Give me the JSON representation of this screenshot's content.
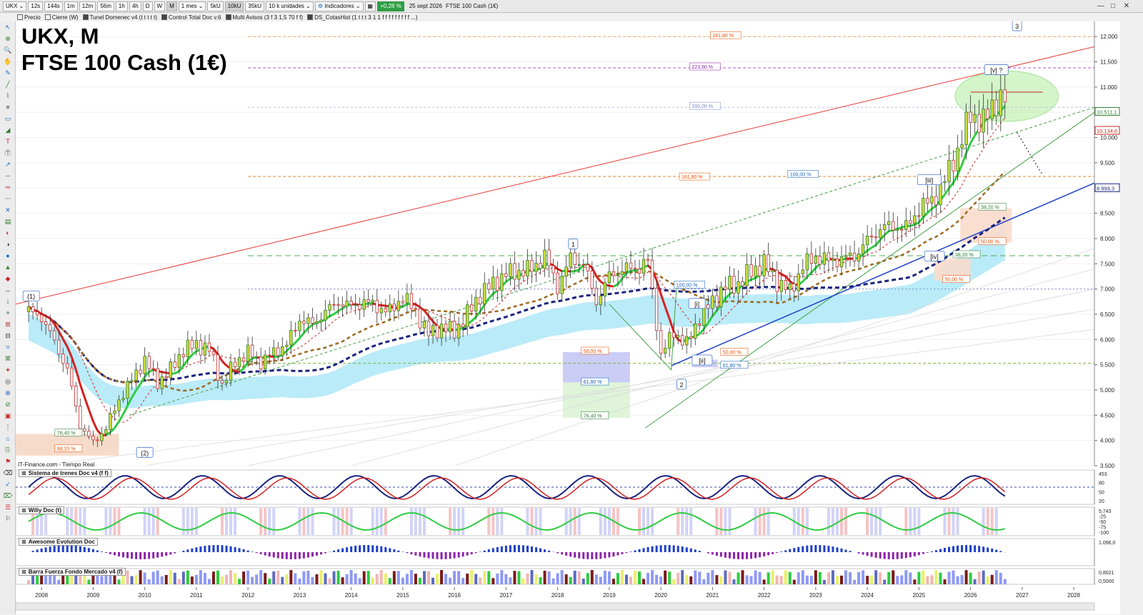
{
  "toolbar": {
    "symbol": "UKX",
    "timeframes": [
      "12s",
      "144s",
      "1m",
      "12m",
      "56m",
      "1h",
      "4h",
      "D",
      "W",
      "M"
    ],
    "period": "1 mes",
    "units_a": "5kU",
    "units_b": "10kU",
    "units_c": "35kU",
    "units_select": "10 k unidades",
    "indicators": "Indicadores",
    "change_pct": "+0,28 %",
    "date": "25 sept 2026",
    "instrument": "FTSE 100 Cash (1€)"
  },
  "legend_items": [
    "Precio",
    "Cierre (W)",
    "Tunel Domenec v4 (t t t t t)",
    "Control Total Doc v.6",
    "Multi Avisos (3 f 3 1,5 70 f f)",
    "DS_CotasHist (1 t t t 3 1 1 f f f f f f f f f ...)"
  ],
  "title": {
    "line1": "UKX, M",
    "line2": "FTSE 100 Cash (1€)"
  },
  "source_label": "IT-Finance.com - Tiempo Real",
  "panes": {
    "p1": "Sistema de trenes Doc v4 (f f)",
    "p2": "Willy Doc (t)",
    "p3": "Awesome Evolution Doc",
    "p4": "Barra Fuerza Fondo Mercado v4 (f)"
  },
  "pane_axis": {
    "p1": [
      "453",
      "80",
      "50",
      "20"
    ],
    "p2": [
      "5,743",
      "-25",
      "-50",
      "-75",
      "-100"
    ],
    "p3": [
      "1.096,0"
    ],
    "p4": [
      "0,8021",
      "0,5000"
    ]
  },
  "price_tags": [
    {
      "label": "10.511,1",
      "value": 10511,
      "color": "#2e7d32"
    },
    {
      "label": "10.134,6",
      "value": 10135,
      "color": "#c62828"
    },
    {
      "label": "8.999,3",
      "value": 8999,
      "color": "#1a237e"
    }
  ],
  "fib_labels": [
    {
      "text": "161,80 %",
      "value": 12000,
      "color": "#e65100"
    },
    {
      "text": "223,60 %",
      "value": 11380,
      "color": "#8e24aa"
    },
    {
      "text": "200,00 %",
      "value": 10600,
      "color": "#7986cb"
    },
    {
      "text": "161,80 %",
      "value": 9200,
      "color": "#e65100"
    },
    {
      "text": "100,00 %",
      "value": 9250,
      "color": "#1565c0"
    },
    {
      "text": "38,20 %",
      "value": 8600,
      "color": "#2e7d32"
    },
    {
      "text": "50,00 %",
      "value": 7920,
      "color": "#e65100"
    },
    {
      "text": "38,20 %",
      "value": 7660,
      "color": "#2e7d32"
    },
    {
      "text": "50,00 %",
      "value": 7170,
      "color": "#e65100"
    },
    {
      "text": "100,00 %",
      "value": 7060,
      "color": "#1565c0"
    },
    {
      "text": "50,00 %",
      "value": 5750,
      "color": "#e65100"
    },
    {
      "text": "61,80 %",
      "value": 5140,
      "color": "#1565c0"
    },
    {
      "text": "76,40 %",
      "value": 4470,
      "color": "#2e7d32"
    },
    {
      "text": "50,00 %",
      "value": 5730,
      "color": "#e65100"
    },
    {
      "text": "61,80 %",
      "value": 5470,
      "color": "#1565c0"
    },
    {
      "text": "76,40 %",
      "value": 4130,
      "color": "#2e7d32"
    },
    {
      "text": "88,20 %",
      "value": 3820,
      "color": "#e65100"
    }
  ],
  "wave_labels": [
    "(1)",
    "(2)",
    "1",
    "2",
    "3",
    "[i]",
    "[ii]",
    "[iii]",
    "[iv]",
    "[v] ?"
  ],
  "colors": {
    "up_candle": "#2e7d32",
    "down_candle": "#c62828",
    "up_fill": "#cddc39",
    "tunnel_fill": "#aee8f7",
    "long_ma": "#1a237e",
    "trend_line": "#e53935",
    "support_line": "#1e3fc8"
  },
  "chart_data": {
    "type": "candlestick",
    "title": "UKX, M",
    "subtitle": "FTSE 100 Cash (1€)",
    "frequency": "monthly",
    "x_ticks": [
      "2008",
      "2009",
      "2010",
      "2011",
      "2012",
      "2013",
      "2014",
      "2015",
      "2016",
      "2017",
      "2018",
      "2019",
      "2020",
      "2021",
      "2022",
      "2023",
      "2024",
      "2025",
      "2026",
      "2027",
      "2028"
    ],
    "y_ticks": [
      "3.500",
      "4.000",
      "4.500",
      "5.000",
      "5.500",
      "6.000",
      "6.500",
      "7.000",
      "7.500",
      "8.000",
      "8.500",
      "9.000",
      "9.500",
      "10.000",
      "10.500",
      "11.000",
      "11.500",
      "12.000"
    ],
    "ylim": [
      3500,
      12300
    ],
    "xlim_years": [
      2007.5,
      2028.4
    ],
    "quarterly_close": [
      {
        "t": 2007.75,
        "close": 6550
      },
      {
        "t": 2008.0,
        "close": 6450
      },
      {
        "t": 2008.25,
        "close": 5950
      },
      {
        "t": 2008.5,
        "close": 5400
      },
      {
        "t": 2008.75,
        "close": 4300
      },
      {
        "t": 2009.0,
        "close": 3950
      },
      {
        "t": 2009.25,
        "close": 4250
      },
      {
        "t": 2009.5,
        "close": 4800
      },
      {
        "t": 2009.75,
        "close": 5200
      },
      {
        "t": 2010.0,
        "close": 5600
      },
      {
        "t": 2010.25,
        "close": 5150
      },
      {
        "t": 2010.5,
        "close": 5400
      },
      {
        "t": 2010.75,
        "close": 5800
      },
      {
        "t": 2011.0,
        "close": 5900
      },
      {
        "t": 2011.25,
        "close": 5800
      },
      {
        "t": 2011.5,
        "close": 5100
      },
      {
        "t": 2011.75,
        "close": 5550
      },
      {
        "t": 2012.0,
        "close": 5750
      },
      {
        "t": 2012.25,
        "close": 5550
      },
      {
        "t": 2012.5,
        "close": 5750
      },
      {
        "t": 2012.75,
        "close": 5900
      },
      {
        "t": 2013.0,
        "close": 6400
      },
      {
        "t": 2013.25,
        "close": 6300
      },
      {
        "t": 2013.5,
        "close": 6550
      },
      {
        "t": 2013.75,
        "close": 6750
      },
      {
        "t": 2014.0,
        "close": 6650
      },
      {
        "t": 2014.25,
        "close": 6750
      },
      {
        "t": 2014.5,
        "close": 6650
      },
      {
        "t": 2014.75,
        "close": 6550
      },
      {
        "t": 2015.0,
        "close": 6850
      },
      {
        "t": 2015.25,
        "close": 6550
      },
      {
        "t": 2015.5,
        "close": 6100
      },
      {
        "t": 2015.75,
        "close": 6250
      },
      {
        "t": 2016.0,
        "close": 6150
      },
      {
        "t": 2016.25,
        "close": 6500
      },
      {
        "t": 2016.5,
        "close": 6900
      },
      {
        "t": 2016.75,
        "close": 7100
      },
      {
        "t": 2017.0,
        "close": 7300
      },
      {
        "t": 2017.25,
        "close": 7350
      },
      {
        "t": 2017.5,
        "close": 7400
      },
      {
        "t": 2017.75,
        "close": 7650
      },
      {
        "t": 2018.0,
        "close": 7050
      },
      {
        "t": 2018.25,
        "close": 7600
      },
      {
        "t": 2018.5,
        "close": 7500
      },
      {
        "t": 2018.75,
        "close": 6750
      },
      {
        "t": 2019.0,
        "close": 7250
      },
      {
        "t": 2019.25,
        "close": 7400
      },
      {
        "t": 2019.5,
        "close": 7400
      },
      {
        "t": 2019.75,
        "close": 7550
      },
      {
        "t": 2020.0,
        "close": 5700
      },
      {
        "t": 2020.25,
        "close": 6150
      },
      {
        "t": 2020.5,
        "close": 5900
      },
      {
        "t": 2020.75,
        "close": 6450
      },
      {
        "t": 2021.0,
        "close": 6750
      },
      {
        "t": 2021.25,
        "close": 7050
      },
      {
        "t": 2021.5,
        "close": 7100
      },
      {
        "t": 2021.75,
        "close": 7350
      },
      {
        "t": 2022.0,
        "close": 7500
      },
      {
        "t": 2022.25,
        "close": 7150
      },
      {
        "t": 2022.5,
        "close": 6950
      },
      {
        "t": 2022.75,
        "close": 7450
      },
      {
        "t": 2023.0,
        "close": 7650
      },
      {
        "t": 2023.25,
        "close": 7550
      },
      {
        "t": 2023.5,
        "close": 7600
      },
      {
        "t": 2023.75,
        "close": 7650
      },
      {
        "t": 2024.0,
        "close": 7950
      },
      {
        "t": 2024.25,
        "close": 8200
      },
      {
        "t": 2024.5,
        "close": 8250
      },
      {
        "t": 2024.75,
        "close": 8200
      },
      {
        "t": 2025.0,
        "close": 8600
      },
      {
        "t": 2025.25,
        "close": 8750
      },
      {
        "t": 2025.5,
        "close": 9150
      },
      {
        "t": 2025.75,
        "close": 9750
      },
      {
        "t": 2026.0,
        "close": 10450
      },
      {
        "t": 2026.25,
        "close": 10300
      },
      {
        "t": 2026.5,
        "close": 10750
      },
      {
        "t": 2026.7,
        "close": 10780
      }
    ]
  }
}
